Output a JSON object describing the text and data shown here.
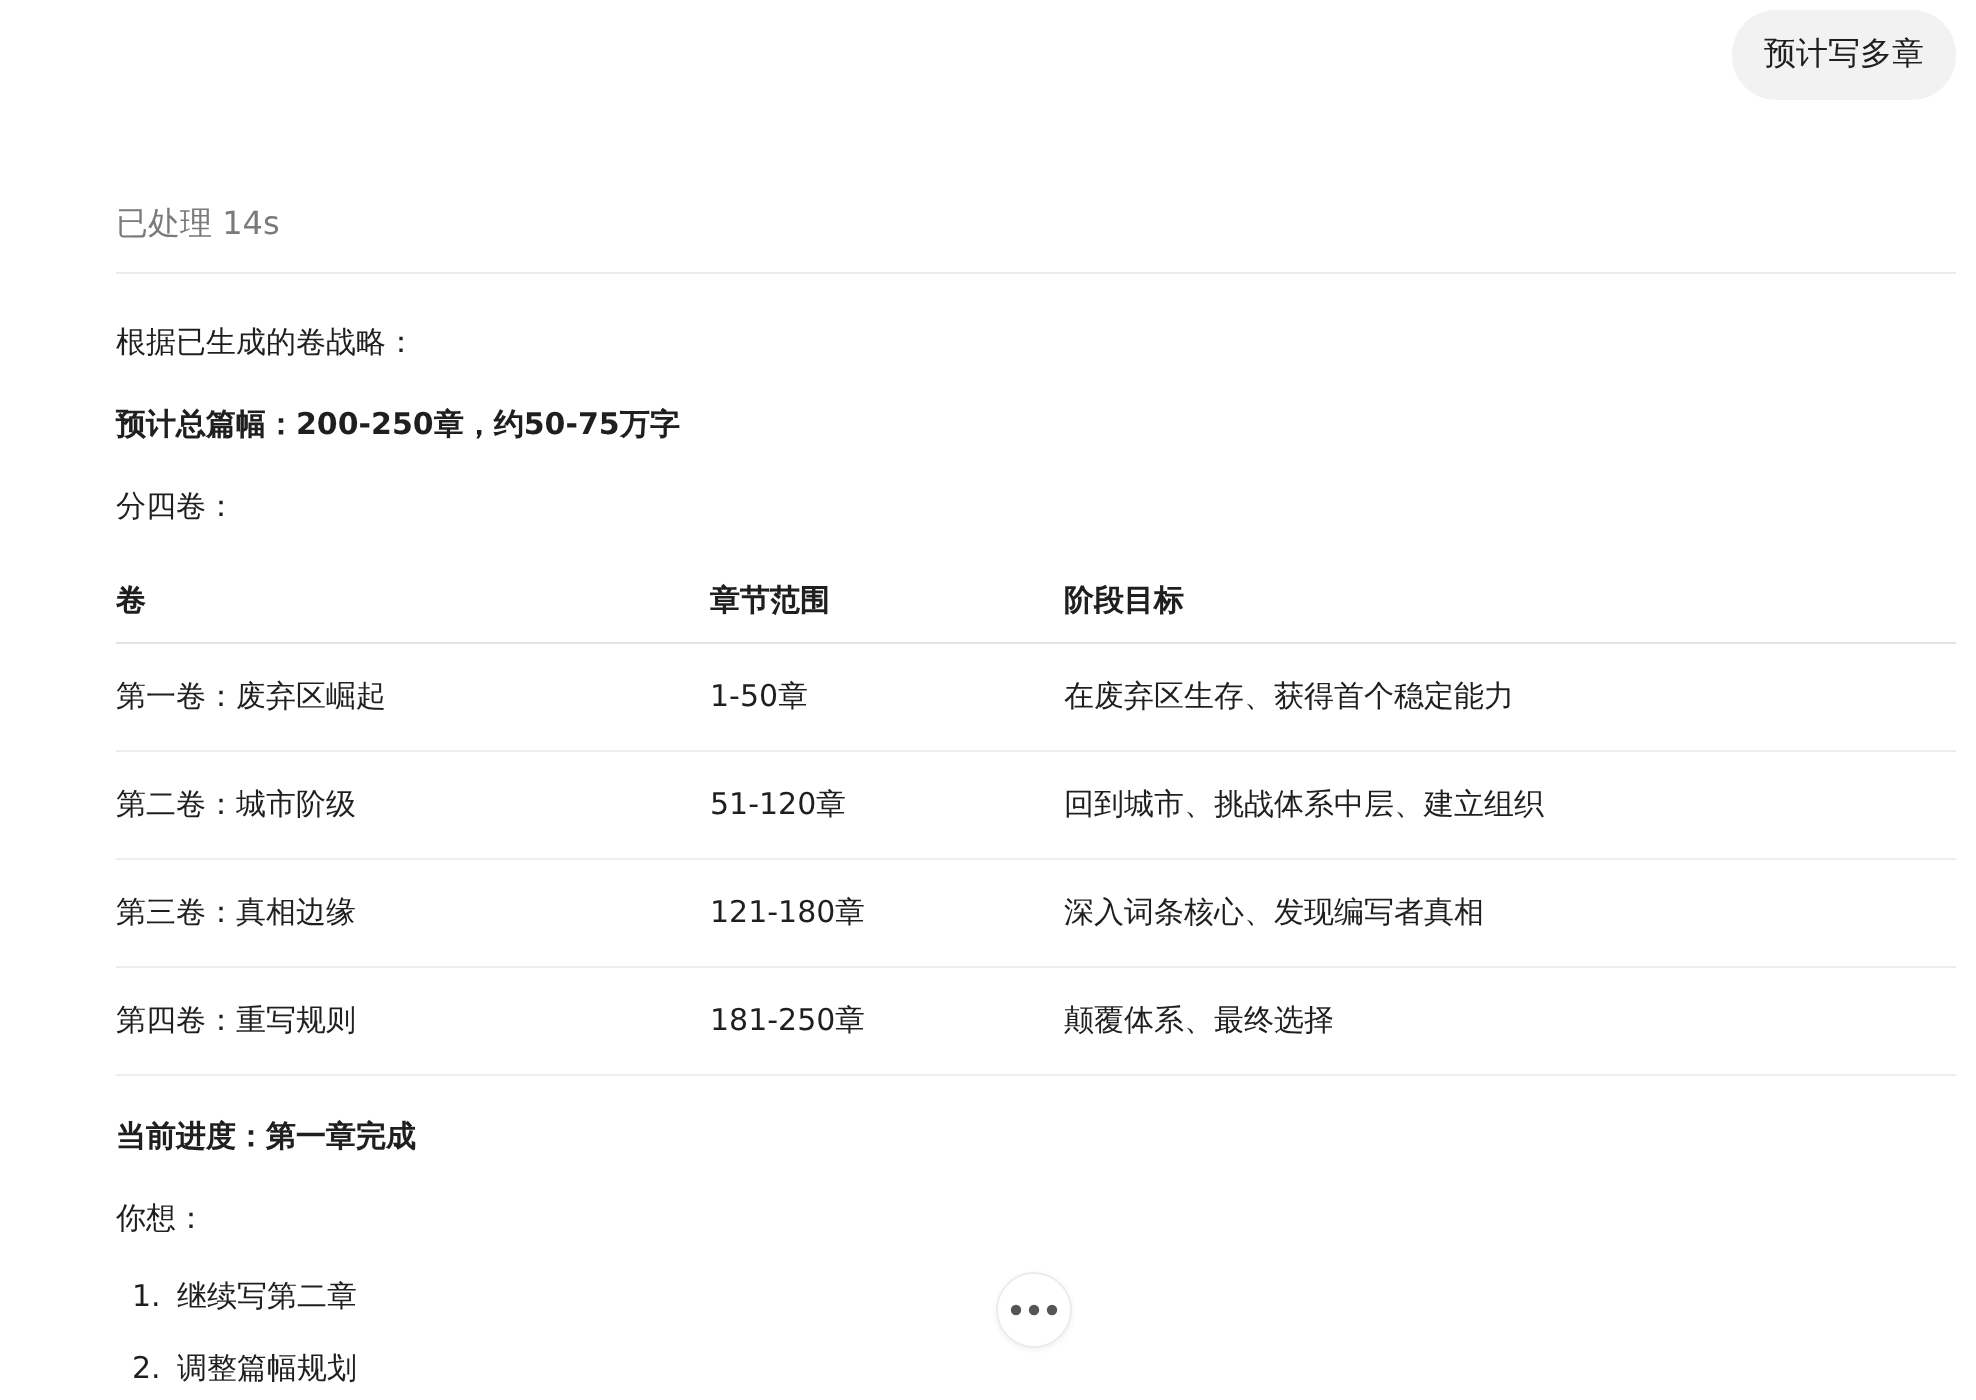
{
  "user_message": {
    "text": "预计写多章"
  },
  "status": {
    "text": "已处理 14s"
  },
  "paragraphs": [
    {
      "kind": "plain",
      "text": "根据已生成的卷战略："
    },
    {
      "kind": "bold",
      "text": "预计总篇幅：200-250章，约50-75万字"
    },
    {
      "kind": "plain",
      "text": "分四卷："
    }
  ],
  "table": {
    "columns": [
      "卷",
      "章节范围",
      "阶段目标"
    ],
    "rows": [
      [
        "第一卷：废弃区崛起",
        "1-50章",
        "在废弃区生存、获得首个稳定能力"
      ],
      [
        "第二卷：城市阶级",
        "51-120章",
        "回到城市、挑战体系中层、建立组织"
      ],
      [
        "第三卷：真相边缘",
        "121-180章",
        "深入词条核心、发现编写者真相"
      ],
      [
        "第四卷：重写规则",
        "181-250章",
        "颠覆体系、最终选择"
      ]
    ]
  },
  "after": [
    {
      "kind": "bold",
      "text": "当前进度：第一章完成"
    },
    {
      "kind": "plain",
      "text": "你想："
    }
  ],
  "options": [
    {
      "number": "1.",
      "text": "继续写第二章"
    },
    {
      "number": "2.",
      "text": "调整篇幅规划"
    }
  ]
}
